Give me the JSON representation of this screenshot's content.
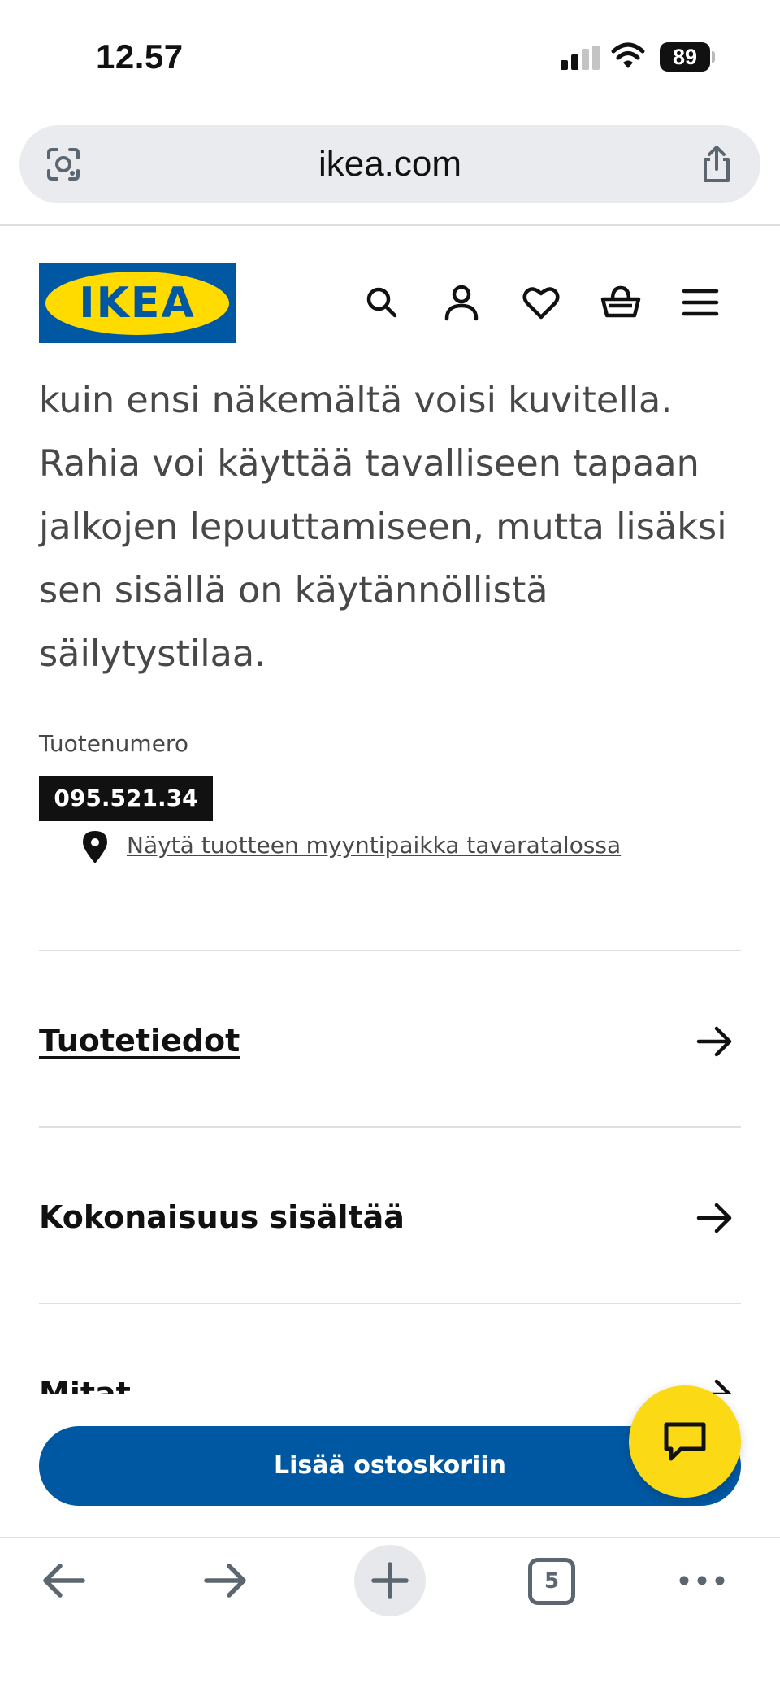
{
  "status_bar": {
    "time": "12.57",
    "battery": "89"
  },
  "browser": {
    "url": "ikea.com",
    "tab_count": "5"
  },
  "header": {
    "logo_text": "IKEA"
  },
  "product": {
    "description": "kuin ensi näkemältä voisi kuvitella. Rahia voi käyttää tavalliseen tapaan jalkojen lepuuttamiseen, mutta lisäksi sen sisällä on käytännöllistä säilytystilaa.",
    "product_number_label": "Tuotenumero",
    "product_number": "095.521.34",
    "store_location_link": "Näytä tuotteen myyntipaikka tavaratalossa"
  },
  "accordion": {
    "items": [
      {
        "label": "Tuotetiedot"
      },
      {
        "label": "Kokonaisuus sisältää"
      },
      {
        "label": "Mitat"
      }
    ]
  },
  "cta": {
    "add_to_cart": "Lisää ostoskoriin"
  },
  "colors": {
    "ikea_blue": "#0058a3",
    "ikea_yellow": "#ffdb00",
    "chat_yellow": "#fbd914"
  }
}
